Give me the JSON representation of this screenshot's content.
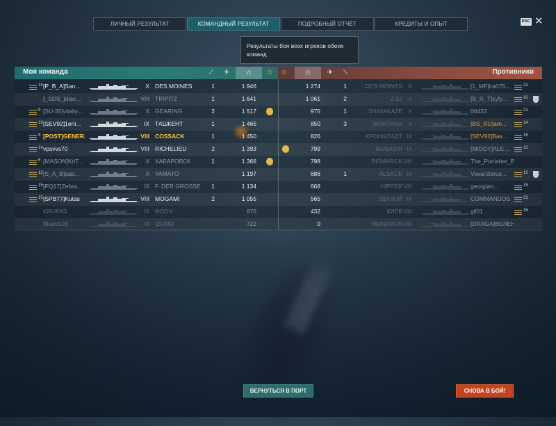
{
  "tabs": [
    {
      "label": "ЛИЧНЫЙ РЕЗУЛЬТАТ",
      "active": false
    },
    {
      "label": "КОМАНДНЫЙ РЕЗУЛЬТАТ",
      "active": true
    },
    {
      "label": "ПОДРОБНЫЙ ОТЧЁТ",
      "active": false
    },
    {
      "label": "КРЕДИТЫ И ОПЫТ",
      "active": false
    }
  ],
  "esc_label": "ESC",
  "close_glyph": "✕",
  "tooltip": "Результаты боя всех игроков обеих команд",
  "left_team": {
    "title": "Моя команда",
    "header_icons": [
      "torpedo-icon",
      "plane-icon",
      "star-icon",
      "medal-icon"
    ],
    "rows": [
      {
        "level": "15",
        "name": "[P_B_A]San...",
        "tier": "X",
        "ship": "DES MOINES",
        "kills": "1",
        "score": "1 946",
        "medal": false,
        "state": "bright"
      },
      {
        "level": "",
        "name": "[_SDS_]diac...",
        "tier": "VIII",
        "ship": "TIRPITZ",
        "kills": "1",
        "score": "1 641",
        "medal": false,
        "state": "mixed"
      },
      {
        "level": "9",
        "name": "[SU-35]vitaliy...",
        "tier": "X",
        "ship": "GEARING",
        "kills": "2",
        "score": "1 517",
        "medal": true,
        "state": "mixed"
      },
      {
        "level": "10",
        "name": "[SEV92]1eni...",
        "tier": "IX",
        "ship": "ТАШКЕНТ",
        "kills": "1",
        "score": "1 465",
        "medal": false,
        "state": "bright"
      },
      {
        "level": "9",
        "name": "[POST]GENER...",
        "tier": "VIII",
        "ship": "COSSACK",
        "kills": "1",
        "score": "1 450",
        "medal": false,
        "state": "self"
      },
      {
        "level": "14",
        "name": "vpsvvs70",
        "tier": "VIII",
        "ship": "RICHELIEU",
        "kills": "2",
        "score": "1 393",
        "medal": false,
        "state": "bright"
      },
      {
        "level": "6",
        "name": "[MASON]KriT...",
        "tier": "X",
        "ship": "ХАБАРОВСК",
        "kills": "1",
        "score": "1 366",
        "medal": true,
        "state": "mixed"
      },
      {
        "level": "12",
        "name": "[S_A_B]sab...",
        "tier": "X",
        "ship": "YAMATO",
        "kills": "",
        "score": "1 197",
        "medal": false,
        "state": "mixed"
      },
      {
        "level": "15",
        "name": "[PQ17]Zebra...",
        "tier": "IX",
        "ship": "F. DER GROSSE",
        "kills": "1",
        "score": "1 134",
        "medal": false,
        "state": "mixed"
      },
      {
        "level": "15",
        "name": "[SPB77]Kutas",
        "tier": "VIII",
        "ship": "MOGAMI",
        "kills": "2",
        "score": "1 055",
        "medal": false,
        "state": "bright"
      },
      {
        "level": "",
        "name": "KRUPAS",
        "tier": "IX",
        "ship": "ROON",
        "kills": "",
        "score": "875",
        "medal": false,
        "state": "dead"
      },
      {
        "level": "",
        "name": "Blade926",
        "tier": "IX",
        "ship": "IZUMO",
        "kills": "",
        "score": "722",
        "medal": false,
        "state": "dead"
      }
    ]
  },
  "right_team": {
    "title": "Противники",
    "header_icons": [
      "medal-icon",
      "star-icon",
      "plane-icon",
      "torpedo-icon"
    ],
    "rows": [
      {
        "medal": false,
        "score": "1 274",
        "kills": "1",
        "ship": "DES MOINES",
        "tier": "X",
        "name": "[1_MF]ira075...",
        "level": "22",
        "state": "dead"
      },
      {
        "medal": false,
        "score": "1 061",
        "kills": "2",
        "ship": "Z-52",
        "tier": "X",
        "name": "[B_R_T]cyfy...",
        "level": "10",
        "state": "dead"
      },
      {
        "medal": false,
        "score": "975",
        "kills": "1",
        "ship": "SHIMAKAZE",
        "tier": "X",
        "name": "00422",
        "level": "21",
        "state": "dead"
      },
      {
        "medal": false,
        "score": "850",
        "kills": "3",
        "ship": "MONTANA",
        "tier": "X",
        "name": "[BS_RU]am...",
        "level": "14",
        "state": "dead"
      },
      {
        "medal": false,
        "score": "826",
        "kills": "",
        "ship": "КРОНШТАДТ",
        "tier": "IX",
        "name": "[SEV92]Bas...",
        "level": "15",
        "state": "dead"
      },
      {
        "medal": true,
        "score": "799",
        "kills": "",
        "ship": "MUSASHI",
        "tier": "IX",
        "name": "[MIDDY]ALE...",
        "level": "10",
        "state": "dead"
      },
      {
        "medal": false,
        "score": "798",
        "kills": "",
        "ship": "BISMARCK",
        "tier": "VIII",
        "name": "The_Punisher_Bra...",
        "level": "",
        "state": "dead"
      },
      {
        "medal": false,
        "score": "686",
        "kills": "1",
        "ship": "ALSACE",
        "tier": "IX",
        "name": "Vovan3arus...",
        "level": "15",
        "state": "dead"
      },
      {
        "medal": false,
        "score": "668",
        "kills": "",
        "ship": "HIPPER",
        "tier": "VIII",
        "name": "georgian...",
        "level": "15",
        "state": "dead"
      },
      {
        "medal": false,
        "score": "565",
        "kills": "",
        "ship": "УДАЛОЙ",
        "tier": "IX",
        "name": "COMMANDOS",
        "level": "23",
        "state": "dead"
      },
      {
        "medal": false,
        "score": "432",
        "kills": "",
        "ship": "КИЕВ",
        "tier": "VIII",
        "name": "gil01",
        "level": "16",
        "state": "dead"
      },
      {
        "medal": false,
        "score": "0",
        "kills": "",
        "ship": "MONARCH",
        "tier": "VIII",
        "name": "[DRAGA]ВОЛЕНАТ...",
        "level": "",
        "state": "dead"
      }
    ]
  },
  "buttons": {
    "port": "ВЕРНУТЬСЯ В ПОРТ",
    "battle": "СНОВА В БОЙ!"
  },
  "colors": {
    "my_team": "#1e6d70",
    "enemy_team": "#8a4b40",
    "self_highlight": "#ffc33b",
    "clan_highlight": "#e59b3a",
    "port_button": "#2d6d6c",
    "battle_button": "#c4431e"
  }
}
